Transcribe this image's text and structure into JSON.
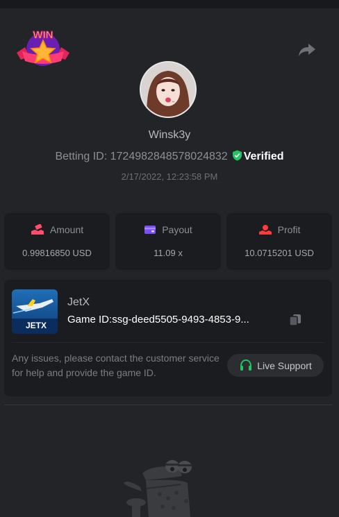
{
  "profile": {
    "username": "Winsk3y",
    "betting_id_label": "Betting ID:",
    "betting_id": "1724982848578024832",
    "verified_label": "Verified",
    "datetime": "2/17/2022, 12:23:58 PM"
  },
  "badge": {
    "text": "WIN",
    "icon": "win-star-badge-icon"
  },
  "share": {
    "icon": "share-arrow-icon"
  },
  "stats": [
    {
      "label": "Amount",
      "value": "0.99816850 USD",
      "icon": "amount-hand-icon",
      "color": "#ff4d6d"
    },
    {
      "label": "Payout",
      "value": "11.09 x",
      "icon": "wallet-icon",
      "color": "#7b4dff"
    },
    {
      "label": "Profit",
      "value": "10.0715201 USD",
      "icon": "profit-hand-icon",
      "color": "#ff3b3b"
    }
  ],
  "game": {
    "name": "JetX",
    "thumb_label": "JETX",
    "id_label": "Game ID:",
    "id_value": "ssg-deed5505-9493-4853-9...",
    "copy_icon": "copy-icon"
  },
  "support": {
    "help_text": "Any issues, please contact the customer service for help and provide the game ID.",
    "button_label": "Live Support",
    "icon": "headset-icon"
  },
  "colors": {
    "background": "#232427",
    "card": "#1b1c1f",
    "verified_green": "#22c55e",
    "support_green": "#22c55e"
  }
}
